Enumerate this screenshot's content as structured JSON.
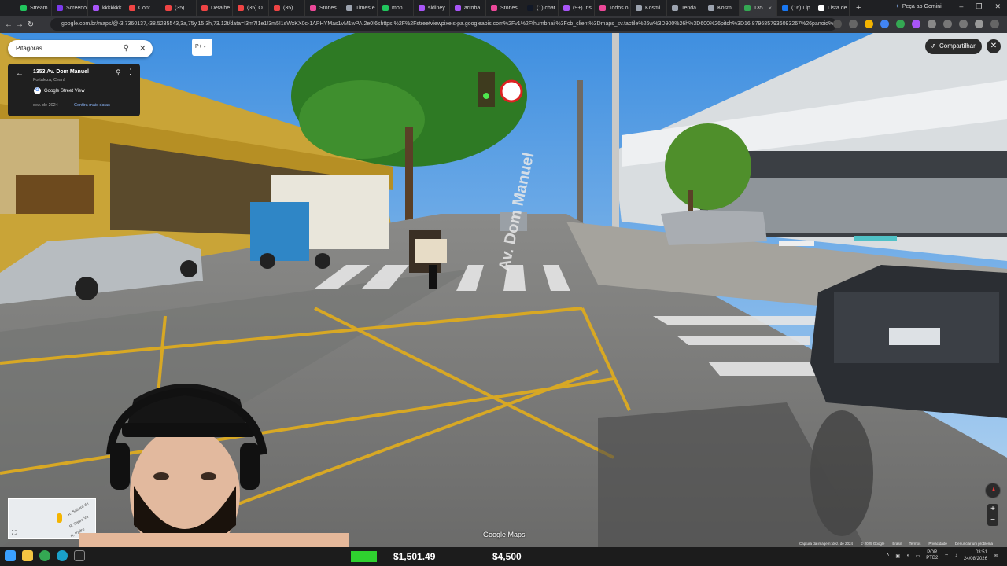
{
  "browser": {
    "tabs": [
      {
        "label": "Stream",
        "color": "#21c55d"
      },
      {
        "label": "Screeno",
        "color": "#7c3aed"
      },
      {
        "label": "kkkkkkk",
        "color": "#a855f7"
      },
      {
        "label": "Cont",
        "color": "#ef4444"
      },
      {
        "label": "(35)",
        "color": "#ef4444"
      },
      {
        "label": "Detalhe",
        "color": "#ef4444"
      },
      {
        "label": "(35) O",
        "color": "#ef4444"
      },
      {
        "label": "(35)",
        "color": "#ef4444"
      },
      {
        "label": "Stories",
        "color": "#ec4899"
      },
      {
        "label": "Times e",
        "color": "#9ca3af"
      },
      {
        "label": "mon",
        "color": "#21c55d"
      },
      {
        "label": "sidiney",
        "color": "#a855f7"
      },
      {
        "label": "arroba",
        "color": "#a855f7"
      },
      {
        "label": "Stories",
        "color": "#ec4899"
      },
      {
        "label": "(1) chat",
        "color": "#111827"
      },
      {
        "label": "(9+) Ins",
        "color": "#a855f7"
      },
      {
        "label": "Todos o",
        "color": "#ec4899"
      },
      {
        "label": "Kosmi",
        "color": "#9ca3af"
      },
      {
        "label": "Tenda",
        "color": "#9ca3af"
      },
      {
        "label": "Kosmi",
        "color": "#9ca3af"
      },
      {
        "label": "135",
        "color": "#34a853"
      },
      {
        "label": "(16) Lip",
        "color": "#1877f2"
      },
      {
        "label": "Lista de",
        "color": "#ffffff"
      }
    ],
    "active_tab_close": "×",
    "new_tab": "+",
    "gemini_label": "Peça ao Gemini",
    "url": "google.com.br/maps/@-3.7360137,-38.5235543,3a,75y,15.3h,73.12t/data=!3m7!1e1!3m5!1sWxKX0c-1APHYMas1vM1wPA!2e0!6shttps:%2F%2Fstreetviewpixels-pa.googleapis.com%2Fv1%2Fthumbnail%3Fcb_client%3Dmaps_sv.tactile%26w%3D900%26h%3D600%26pitch%3D16.8796857936093267%26panoid%3D..."
  },
  "maps": {
    "search_value": "Pitágoras",
    "pegman_label": "P+",
    "address_title": "1353 Av. Dom Manuel",
    "address_city": "Fortaleza, Ceará",
    "provider": "Google Street View",
    "capture_date": "dez. de 2024",
    "more_dates_link": "Confira mais datas",
    "share_label": "Compartilhar",
    "watermark": "Google Maps",
    "attribution": [
      "Captura da imagem: dez. de 2024",
      "© 2025 Google",
      "Brasil",
      "Termos",
      "Privacidade",
      "Denunciar um problema"
    ],
    "road_marking": "Av. Dom Manuel",
    "minimap_streets": [
      "R. Sabara de",
      "R. Padre Va",
      "R. Padre"
    ]
  },
  "overlay": {
    "money_1": "$1,501.49",
    "money_2": "$4,500"
  },
  "taskbar": {
    "lang_1": "POR",
    "lang_2": "PTB2",
    "time": "03:51",
    "date": "24/08/2026"
  },
  "colors": {
    "accent": "#2fd12f",
    "link": "#8ab4f8"
  }
}
